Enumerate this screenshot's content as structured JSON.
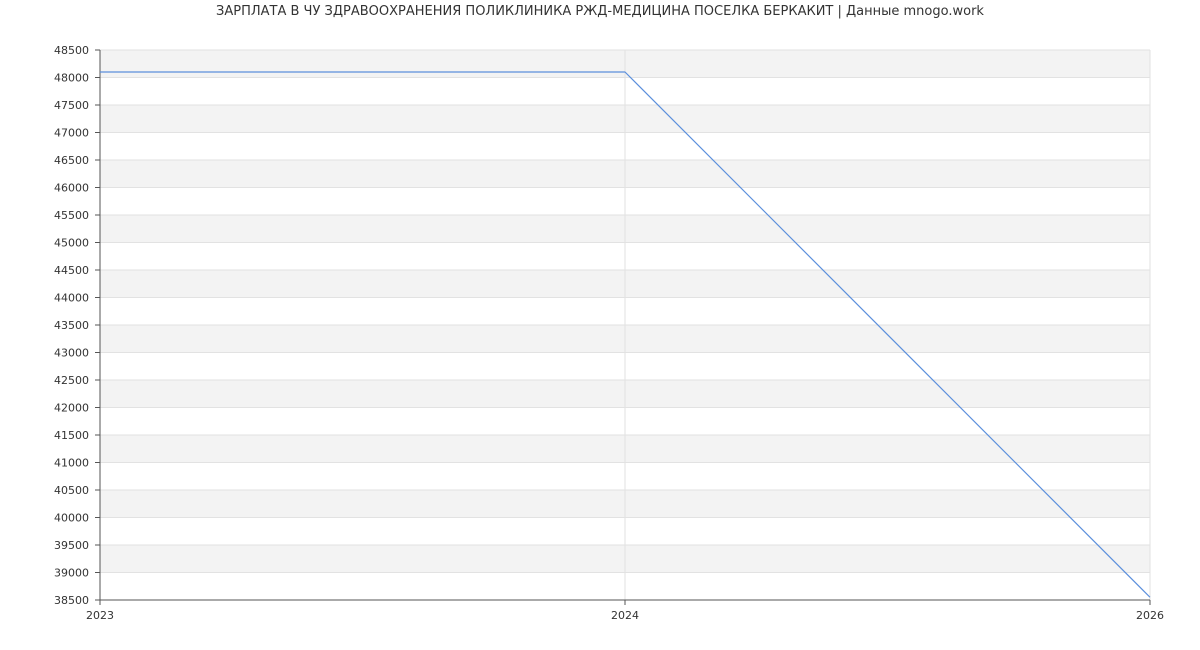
{
  "chart_data": {
    "type": "line",
    "title": "ЗАРПЛАТА В ЧУ ЗДРАВООХРАНЕНИЯ ПОЛИКЛИНИКА РЖД-МЕДИЦИНА ПОСЕЛКА БЕРКАКИТ | Данные mnogo.work",
    "xlabel": "",
    "ylabel": "",
    "x_ticks": [
      "2023",
      "2024",
      "2026"
    ],
    "y_ticks": [
      "38500",
      "39000",
      "39500",
      "40000",
      "40500",
      "41000",
      "41500",
      "42000",
      "42500",
      "43000",
      "43500",
      "44000",
      "44500",
      "45000",
      "45500",
      "46000",
      "46500",
      "47000",
      "47500",
      "48000",
      "48500"
    ],
    "ylim": [
      38500,
      48500
    ],
    "grid": true,
    "legend": "none",
    "series": [
      {
        "color": "#5b8fdc",
        "points": [
          {
            "x": "2023",
            "y": 48100
          },
          {
            "x": "2024",
            "y": 48100
          },
          {
            "x": "2026",
            "y": 38550
          }
        ]
      }
    ],
    "colors": {
      "band_alt": "#f3f3f3",
      "grid": "#e2e2e2",
      "axis": "#555555",
      "line": "#5b8fdc"
    }
  }
}
